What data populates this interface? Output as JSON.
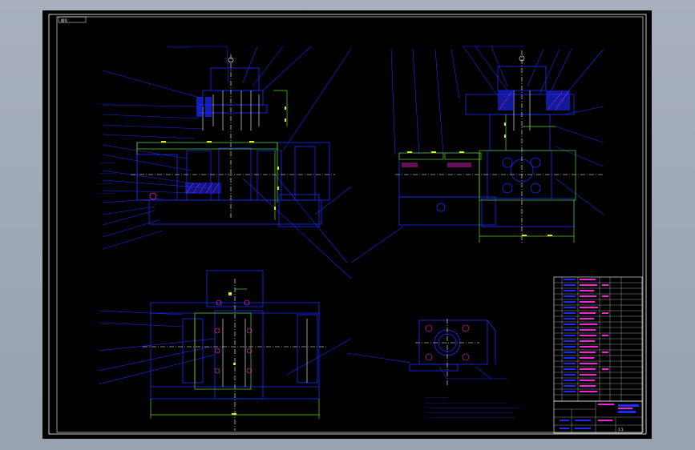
{
  "app": {
    "background": "#9aa4b1",
    "sheet_background": "#000000"
  },
  "colors": {
    "frame": "#ffffff",
    "blue": "#1a2bff",
    "green": "#5bd81c",
    "yellow": "#e8e800",
    "magenta": "#ff22dd",
    "cyan": "#22ddee",
    "white": "#ffffff",
    "red": "#ff3030"
  },
  "drawing": {
    "corner_label": "图号",
    "parts_table_rows": 22,
    "scale": "1:1"
  }
}
